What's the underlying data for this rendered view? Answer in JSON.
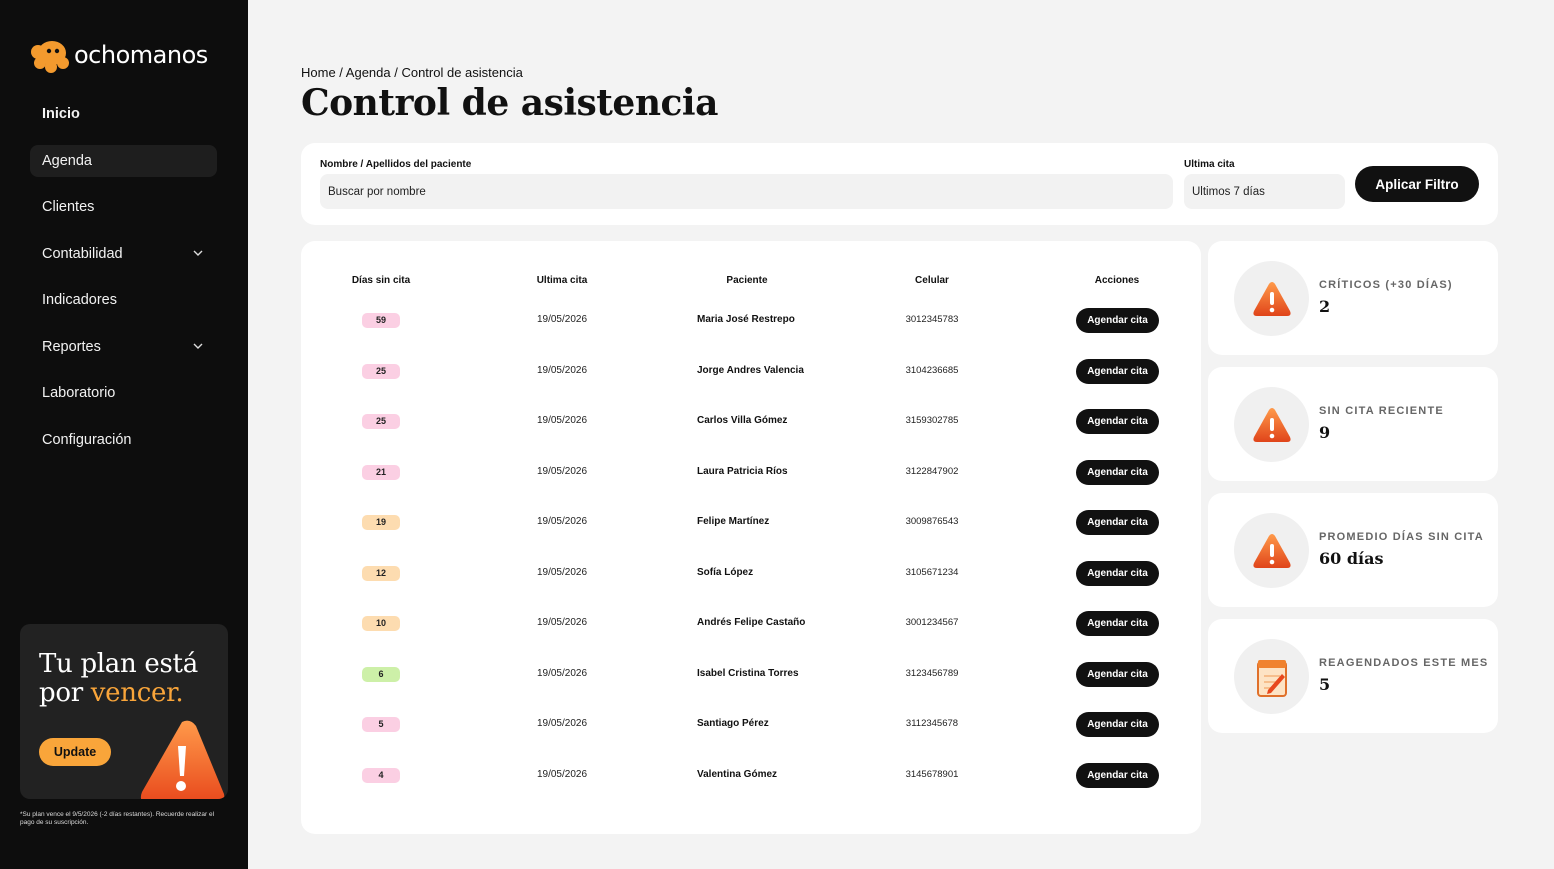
{
  "brand": {
    "name": "ochomanos",
    "color": "#f9a53a"
  },
  "sidebar": {
    "items": [
      {
        "label": "Inicio",
        "chevron": false
      },
      {
        "label": "Agenda",
        "chevron": false,
        "active": true
      },
      {
        "label": "Clientes",
        "chevron": false
      },
      {
        "label": "Contabilidad",
        "chevron": true
      },
      {
        "label": "Indicadores",
        "chevron": false
      },
      {
        "label": "Reportes",
        "chevron": true
      },
      {
        "label": "Laboratorio",
        "chevron": false
      },
      {
        "label": "Configuración",
        "chevron": false
      }
    ],
    "plan": {
      "line1": "Tu plan está",
      "line2_prefix": "por ",
      "line2_accent": "vencer.",
      "button": "Update",
      "note": "*Su plan vence el 9/5/2026 (-2 días restantes). Recuerde realizar el pago de su suscripción."
    }
  },
  "breadcrumb": "Home / Agenda / Control de asistencia",
  "title": "Control de asistencia",
  "filter": {
    "name_label": "Nombre / Apellidos del paciente",
    "name_placeholder": "Buscar por nombre",
    "last_label": "Ultima cita",
    "last_value": "Últimos 7 días",
    "apply": "Aplicar Filtro"
  },
  "table": {
    "headers": [
      "Días sin cita",
      "Ultima cita",
      "Paciente",
      "Celular",
      "Acciones"
    ],
    "action_label": "Agendar cita",
    "rows": [
      {
        "days": "59",
        "tone": "pink",
        "date": "19/05/2026",
        "name": "Maria José Restrepo",
        "phone": "3012345783"
      },
      {
        "days": "25",
        "tone": "pink",
        "date": "19/05/2026",
        "name": "Jorge Andres Valencia",
        "phone": "3104236685"
      },
      {
        "days": "25",
        "tone": "pink",
        "date": "19/05/2026",
        "name": "Carlos Villa Gómez",
        "phone": "3159302785"
      },
      {
        "days": "21",
        "tone": "pink",
        "date": "19/05/2026",
        "name": "Laura Patricia Ríos",
        "phone": "3122847902"
      },
      {
        "days": "19",
        "tone": "orange",
        "date": "19/05/2026",
        "name": "Felipe Martínez",
        "phone": "3009876543"
      },
      {
        "days": "12",
        "tone": "orange",
        "date": "19/05/2026",
        "name": "Sofía López",
        "phone": "3105671234"
      },
      {
        "days": "10",
        "tone": "orange",
        "date": "19/05/2026",
        "name": "Andrés Felipe Castaño",
        "phone": "3001234567"
      },
      {
        "days": "6",
        "tone": "green",
        "date": "19/05/2026",
        "name": "Isabel Cristina Torres",
        "phone": "3123456789"
      },
      {
        "days": "5",
        "tone": "pink",
        "date": "19/05/2026",
        "name": "Santiago Pérez",
        "phone": "3112345678"
      },
      {
        "days": "4",
        "tone": "pink",
        "date": "19/05/2026",
        "name": "Valentina Gómez",
        "phone": "3145678901"
      }
    ]
  },
  "badge_colors": {
    "pink": "#fbcfe3",
    "orange": "#fddcb0",
    "green": "#cdf0a8"
  },
  "stats": [
    {
      "label": "CRÍTICOS (+30 DÍAS)",
      "value": "2",
      "icon": "warning-icon"
    },
    {
      "label": "SIN CITA RECIENTE",
      "value": "9",
      "icon": "warning-icon"
    },
    {
      "label": "PROMEDIO DÍAS SIN CITA",
      "value": "60 días",
      "icon": "warning-icon"
    },
    {
      "label": "REAGENDADOS ESTE MES",
      "value": "5",
      "icon": "notepad-icon"
    }
  ]
}
